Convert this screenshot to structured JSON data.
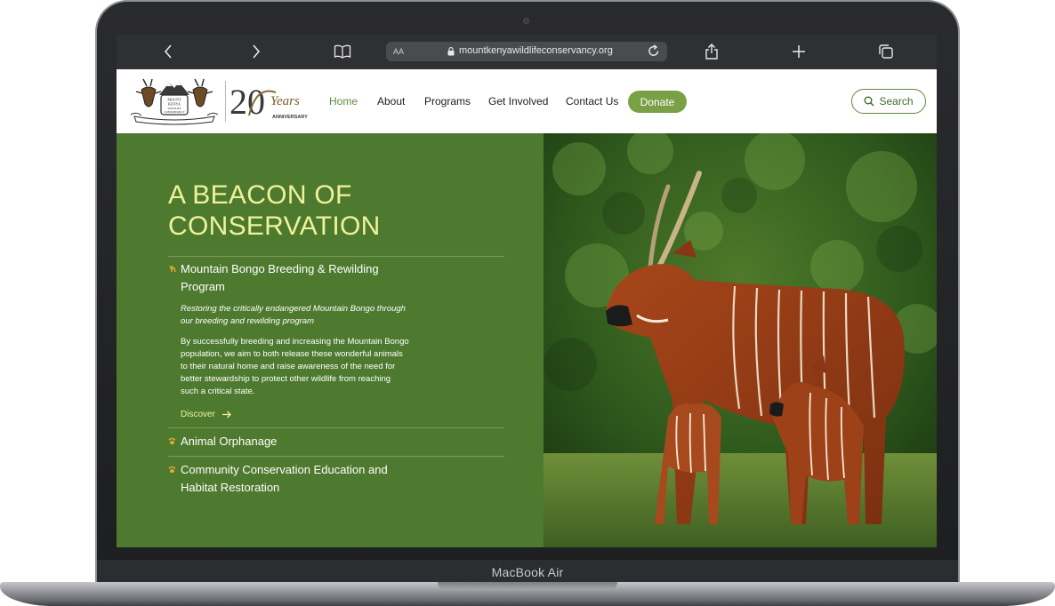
{
  "device": {
    "label": "MacBook Air"
  },
  "browser": {
    "text_size_label": "AA",
    "url": "mountkenyawildlifeconservancy.org"
  },
  "site": {
    "logo_emblem_text": [
      "MOUNT",
      "KENYA",
      "WILDLIFE",
      "CONSERVANCY"
    ],
    "logo_years_number": "20",
    "logo_years_word": "Years",
    "logo_years_caption": "ANNIVERSARY",
    "nav": {
      "home": "Home",
      "about": "About",
      "programs": "Programs",
      "get_involved": "Get Involved",
      "contact": "Contact Us",
      "donate": "Donate",
      "search": "Search"
    }
  },
  "hero": {
    "title_line1": "A BEACON OF",
    "title_line2": "CONSERVATION",
    "programs": [
      {
        "title_line1": "Mountain Bongo Breeding & Rewilding",
        "title_line2": "Program",
        "subtitle_line1": "Restoring the critically endangered Mountain Bongo through",
        "subtitle_line2": "our breeding and rewilding program",
        "body": [
          "By successfully breeding and increasing the Mountain Bongo",
          "population, we aim to both release these wonderful animals",
          "to their natural home and raise awareness of the need for",
          "better stewardship to protect other wildlife from reaching",
          "such a critical state."
        ],
        "cta": "Discover",
        "expanded": true
      },
      {
        "title_line1": "Animal Orphanage",
        "expanded": false
      },
      {
        "title_line1": "Community Conservation Education and",
        "title_line2": "Habitat Restoration",
        "expanded": false
      }
    ]
  },
  "colors": {
    "hero_green": "#4e7a2f",
    "title_yellow": "#eef29a",
    "accent_green": "#7aa045",
    "bullet_gold": "#e8b12e"
  }
}
